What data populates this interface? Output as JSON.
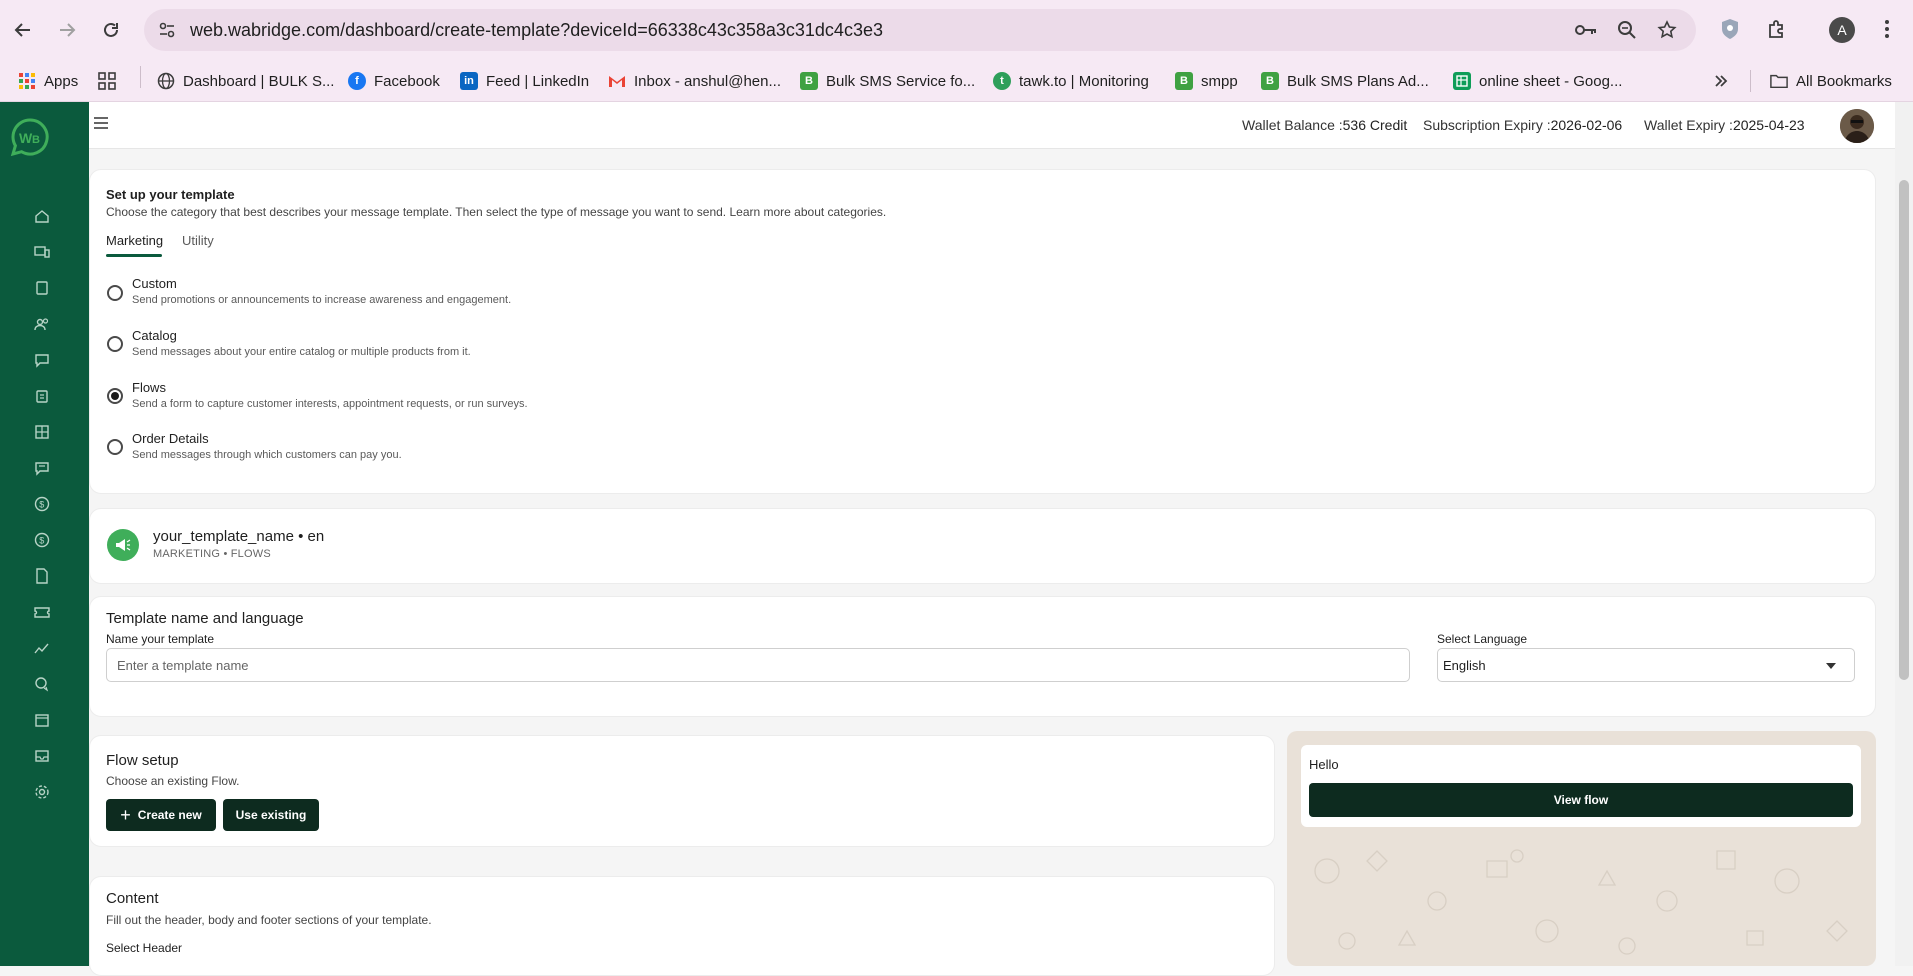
{
  "browser": {
    "url": "web.wabridge.com/dashboard/create-template?deviceId=66338c43c358a3c31dc4c3e3",
    "profile_initial": "A",
    "bookmarks": [
      {
        "label": "Apps",
        "icon": "apps-grid-icon"
      },
      {
        "label": "Dashboard | BULK S...",
        "icon": "globe-icon"
      },
      {
        "label": "Facebook",
        "icon": "facebook-icon"
      },
      {
        "label": "Feed | LinkedIn",
        "icon": "linkedin-icon"
      },
      {
        "label": "Inbox - anshul@hen...",
        "icon": "gmail-icon"
      },
      {
        "label": "Bulk SMS Service fo...",
        "icon": "bulksms-icon"
      },
      {
        "label": "tawk.to | Monitoring",
        "icon": "tawk-icon"
      },
      {
        "label": "smpp",
        "icon": "bulksms-icon"
      },
      {
        "label": "Bulk SMS Plans Ad...",
        "icon": "bulksms-icon"
      },
      {
        "label": "online sheet - Goog...",
        "icon": "sheets-icon"
      }
    ],
    "all_bookmarks": "All Bookmarks"
  },
  "header": {
    "wallet_balance_label": "Wallet Balance :",
    "wallet_balance_value": "536 Credit",
    "subscription_label": "Subscription Expiry :",
    "subscription_value": "2026-02-06",
    "wallet_expiry_label": "Wallet Expiry :",
    "wallet_expiry_value": "2025-04-23"
  },
  "setup": {
    "title": "Set up your template",
    "description": "Choose the category that best describes your message template. Then select the type of message you want to send. Learn more about categories.",
    "tabs": [
      {
        "label": "Marketing",
        "active": true
      },
      {
        "label": "Utility",
        "active": false
      }
    ],
    "options": [
      {
        "label": "Custom",
        "desc": "Send promotions or announcements to increase awareness and engagement.",
        "checked": false
      },
      {
        "label": "Catalog",
        "desc": "Send messages about your entire catalog or multiple products from it.",
        "checked": false
      },
      {
        "label": "Flows",
        "desc": "Send a form to capture customer interests, appointment requests, or run surveys.",
        "checked": true
      },
      {
        "label": "Order Details",
        "desc": "Send messages through which customers can pay you.",
        "checked": false
      }
    ]
  },
  "template_summary": {
    "name": "your_template_name • en",
    "category": "MARKETING • FLOWS"
  },
  "name_language": {
    "title": "Template name and language",
    "name_label": "Name your template",
    "name_placeholder": "Enter a template name",
    "name_value": "",
    "language_label": "Select Language",
    "language_value": "English"
  },
  "flow_setup": {
    "title": "Flow setup",
    "description": "Choose an existing Flow.",
    "create_new": "Create new",
    "use_existing": "Use existing"
  },
  "content": {
    "title": "Content",
    "description": "Fill out the header, body and footer sections of your template.",
    "select_header": "Select Header"
  },
  "preview": {
    "message": "Hello",
    "button": "View flow"
  },
  "colors": {
    "sidebar": "#0b5a3d",
    "dark_button": "#0d2b1f",
    "badge": "#3fae5a",
    "chrome": "#f6e9f4"
  }
}
